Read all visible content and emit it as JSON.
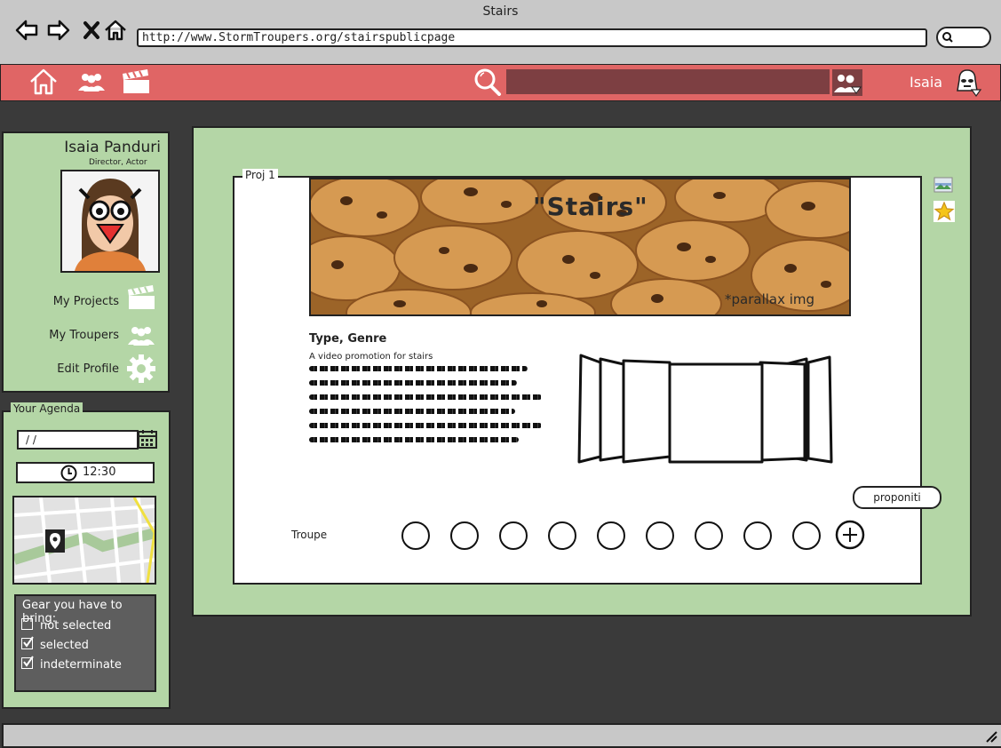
{
  "window": {
    "title": "Stairs",
    "url": "http://www.StormTroupers.org/stairspublicpage"
  },
  "appbar": {
    "user_name": "Isaia"
  },
  "profile": {
    "name": "Isaia Panduri",
    "roles": "Director,  Actor",
    "menu": [
      {
        "label": "My Projects",
        "icon": "clapperboard-icon"
      },
      {
        "label": "My Troupers",
        "icon": "users-icon"
      },
      {
        "label": "Edit Profile",
        "icon": "gear-icon"
      }
    ]
  },
  "agenda": {
    "legend": "Your Agenda",
    "date_value": " /  /",
    "time_value": "12:30",
    "gear": {
      "title": "Gear you have to bring:",
      "items": [
        {
          "label": "not selected",
          "state": "unchecked"
        },
        {
          "label": "selected",
          "state": "checked"
        },
        {
          "label": "indeterminate",
          "state": "checked"
        }
      ]
    }
  },
  "project": {
    "legend": "Proj 1",
    "banner_title": "\"Stairs\"",
    "banner_note": "*parallax img",
    "type_genre": "Type, Genre",
    "description": "A video promotion for stairs",
    "troupe_label": "Troupe",
    "propose_label": "proponiti"
  },
  "colors": {
    "app_bar": "#e06565",
    "panel": "#b4d6a6",
    "search": "#7d3f42",
    "dark_bg": "#3a3a3a"
  }
}
